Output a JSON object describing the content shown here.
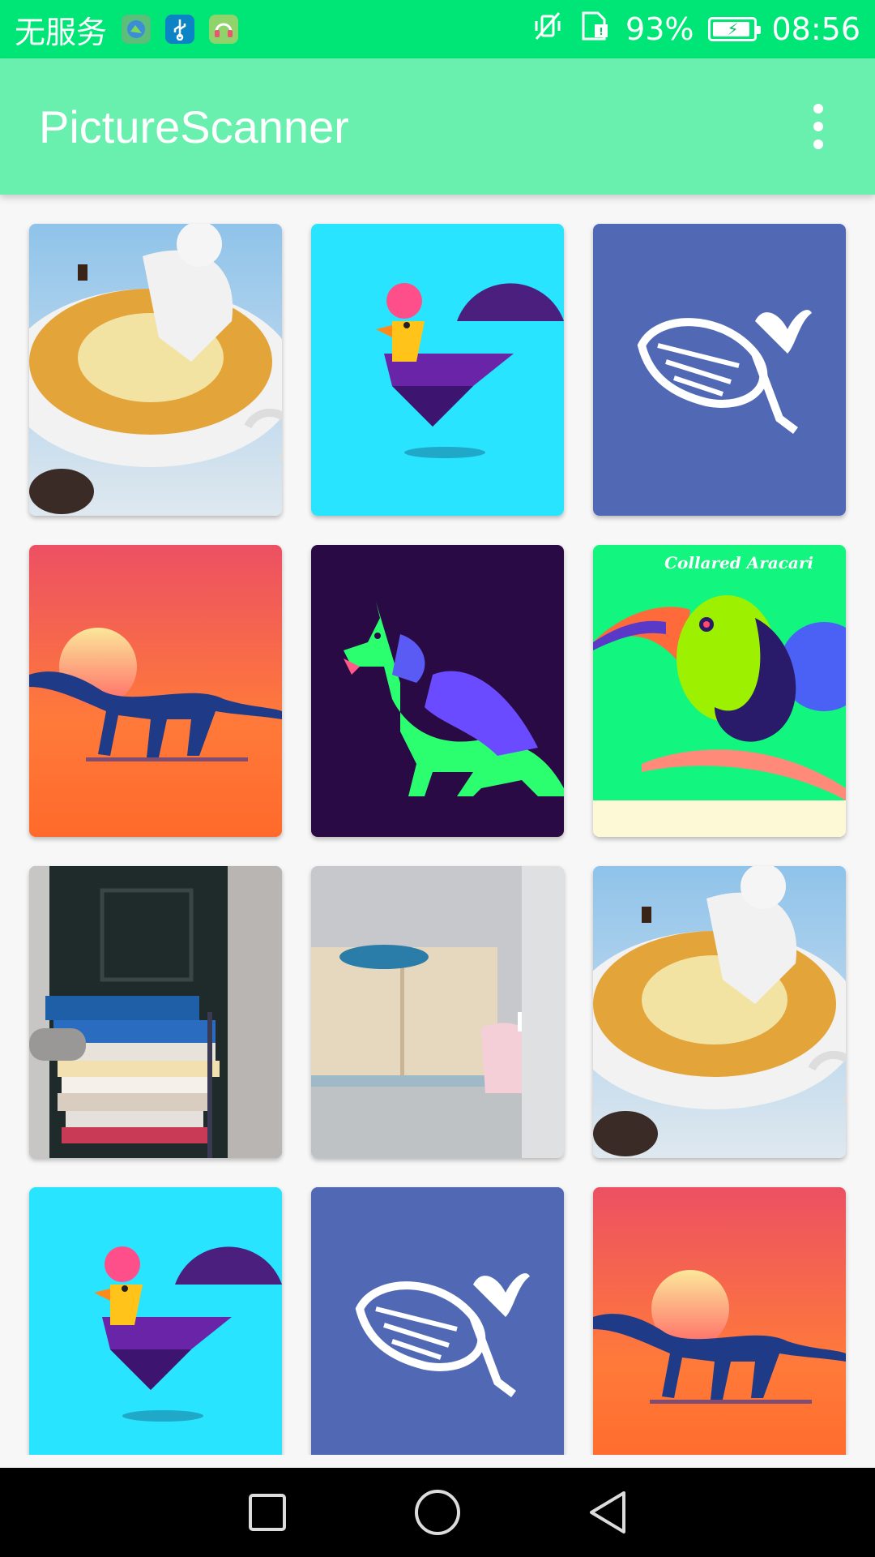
{
  "status_bar": {
    "carrier": "无服务",
    "battery": "93%",
    "battery_level": 0.93,
    "time": "08:56",
    "icons": [
      "sim-app-icon",
      "usb-icon",
      "headset-icon",
      "vibrate-off-icon",
      "sim-signal-icon",
      "battery-charging-icon"
    ]
  },
  "app_bar": {
    "title": "PictureScanner",
    "menu_icon": "more-vert-icon"
  },
  "grid": {
    "items": [
      {
        "subject": "man-in-soup-bowl",
        "caption": ""
      },
      {
        "subject": "rooster",
        "caption": ""
      },
      {
        "subject": "whale",
        "caption": ""
      },
      {
        "subject": "dinosaur-sunset",
        "caption": ""
      },
      {
        "subject": "dog",
        "caption": ""
      },
      {
        "subject": "toucan",
        "caption": "Collared Aracari"
      },
      {
        "subject": "books-stack-photo",
        "caption": ""
      },
      {
        "subject": "cabinet-photo",
        "caption": ""
      },
      {
        "subject": "man-in-soup-bowl",
        "caption": ""
      },
      {
        "subject": "rooster",
        "caption": ""
      },
      {
        "subject": "whale",
        "caption": ""
      },
      {
        "subject": "dinosaur-sunset",
        "caption": ""
      }
    ]
  },
  "nav_bar": {
    "buttons": [
      "recents-button",
      "home-button",
      "back-button"
    ]
  },
  "colors": {
    "status_bar": "#00e676",
    "app_bar": "#69f0ae",
    "background": "#f7f7f7"
  }
}
